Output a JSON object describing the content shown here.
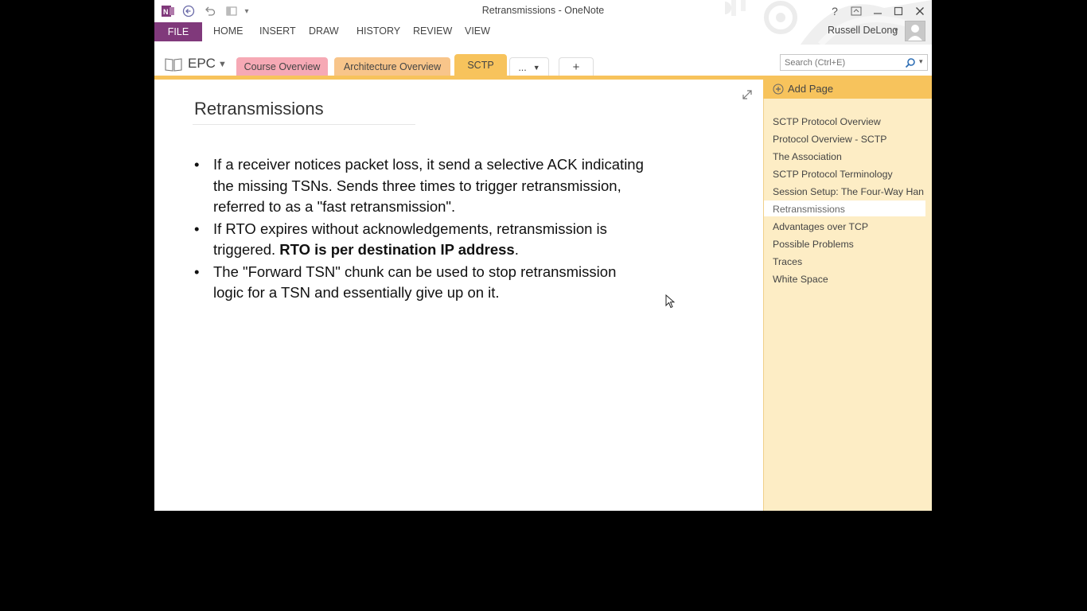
{
  "window": {
    "title": "Retransmissions - OneNote"
  },
  "quick_access": {
    "onenote_icon": "onenote-logo-icon",
    "back_icon": "back-icon",
    "undo_icon": "undo-icon",
    "dock_icon": "dock-icon"
  },
  "window_controls": {
    "help": "?",
    "ribbon_display": "ribbon-display-icon",
    "minimize": "minimize-icon",
    "maximize": "maximize-icon",
    "close": "close-icon"
  },
  "ribbon": {
    "file_tab": "FILE",
    "tabs": [
      "HOME",
      "INSERT",
      "DRAW",
      "HISTORY",
      "REVIEW",
      "VIEW"
    ],
    "user_name": "Russell DeLong"
  },
  "notebook": {
    "name": "EPC"
  },
  "sections": [
    {
      "label": "Course Overview",
      "color": "#f6a9b5"
    },
    {
      "label": "Architecture Overview",
      "color": "#f8c58a"
    },
    {
      "label": "SCTP",
      "color": "#f7c35c"
    },
    {
      "label": "...",
      "color": "#ffffff"
    },
    {
      "label": "+",
      "color": "#ffffff"
    }
  ],
  "search": {
    "placeholder": "Search (Ctrl+E)"
  },
  "page_list": {
    "add_page_label": "Add Page",
    "items": [
      "SCTP Protocol Overview",
      "Protocol Overview - SCTP",
      "The Association",
      "SCTP Protocol Terminology",
      "Session Setup: The Four-Way Han",
      "Retransmissions",
      "Advantages over TCP",
      "Possible Problems",
      "Traces",
      "White Space"
    ],
    "active_index": 5
  },
  "note": {
    "title": "Retransmissions",
    "bullets": [
      {
        "text": "If a receiver notices packet loss, it send a selective ACK indicating the missing TSNs. Sends three times to trigger retransmission, referred to as a \"fast retransmission\"."
      },
      {
        "text": "If RTO expires without acknowledgements, retransmission is triggered. ",
        "bold": "RTO is per destination IP address",
        "tail": "."
      },
      {
        "text": "The \"Forward TSN\" chunk can be used to stop retransmission logic for a TSN and essentially give up on it."
      }
    ]
  },
  "colors": {
    "file_tab": "#80397b",
    "section_accent": "#f7c35c",
    "page_list_bg": "#fdedc5"
  }
}
